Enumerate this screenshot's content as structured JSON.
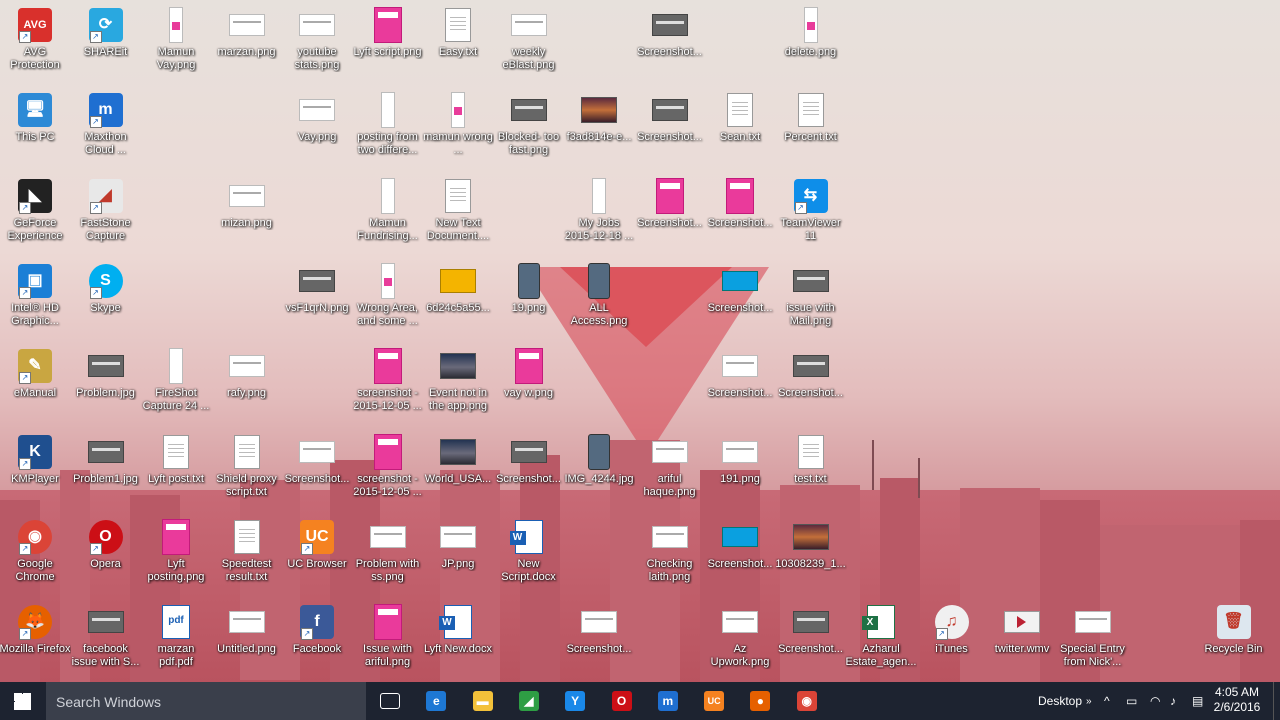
{
  "icons": [
    {
      "id": "avg",
      "label": "AVG Protection",
      "type": "app",
      "color": "#d9302c",
      "glyph": "AVG",
      "shortcut": true
    },
    {
      "id": "shareit",
      "label": "SHAREit",
      "type": "app",
      "color": "#29a8e0",
      "glyph": "⟳",
      "shortcut": true
    },
    {
      "id": "mamun-vay",
      "label": "Mamun Vay.png",
      "type": "tallp"
    },
    {
      "id": "marzan",
      "label": "marzan.png",
      "type": "thumb"
    },
    {
      "id": "youtube-stats",
      "label": "youtube stats.png",
      "type": "thumb"
    },
    {
      "id": "lyft-script",
      "label": "Lyft script.png",
      "type": "pink"
    },
    {
      "id": "easy",
      "label": "Easy.txt",
      "type": "doc"
    },
    {
      "id": "weekly-eblast",
      "label": "weekly eBlast.png",
      "type": "thumb"
    },
    {
      "id": "screenshot-1",
      "label": "Screenshot...",
      "type": "dark"
    },
    {
      "id": "delete",
      "label": "delete.png",
      "type": "tallp"
    },
    {
      "id": "this-pc",
      "label": "This PC",
      "type": "app",
      "color": "#2d8ad6",
      "glyph": "🖥"
    },
    {
      "id": "maxthon",
      "label": "Maxthon Cloud ...",
      "type": "app",
      "color": "#1f6fd1",
      "glyph": "m",
      "shortcut": true
    },
    {
      "id": "vay",
      "label": "Vay.png",
      "type": "thumb"
    },
    {
      "id": "posting-two",
      "label": "posting from two differe...",
      "type": "tall"
    },
    {
      "id": "mamun-wrong",
      "label": "mamun wrong ...",
      "type": "tallp"
    },
    {
      "id": "blocked-too-fast",
      "label": "Blocked- too fast.png",
      "type": "dark"
    },
    {
      "id": "f3ad8",
      "label": "f3ad814e-e...",
      "type": "photo"
    },
    {
      "id": "screenshot-2",
      "label": "Screenshot...",
      "type": "dark"
    },
    {
      "id": "sean",
      "label": "Sean.txt",
      "type": "doc"
    },
    {
      "id": "percent",
      "label": "Percent.txt",
      "type": "doc"
    },
    {
      "id": "geforce",
      "label": "GeForce Experience",
      "type": "app",
      "color": "#222",
      "glyph": "◣",
      "shortcut": true
    },
    {
      "id": "faststone",
      "label": "FastStone Capture",
      "type": "app",
      "color": "#e8e8e8",
      "glyph": "◢",
      "shortcut": true
    },
    {
      "id": "mizan",
      "label": "mizan.png",
      "type": "thumb"
    },
    {
      "id": "mamun-fundrising",
      "label": "Mamun Fundrising...",
      "type": "tall"
    },
    {
      "id": "new-text",
      "label": "New Text Document....",
      "type": "doc"
    },
    {
      "id": "my-jobs",
      "label": "My Jobs 2015-12-18 ...",
      "type": "tall"
    },
    {
      "id": "screenshot-3",
      "label": "Screenshot...",
      "type": "pink"
    },
    {
      "id": "screenshot-4",
      "label": "Screenshot...",
      "type": "pink"
    },
    {
      "id": "teamviewer",
      "label": "TeamViewer 11",
      "type": "app",
      "color": "#0e8ee9",
      "glyph": "⇆",
      "shortcut": true
    },
    {
      "id": "intel-hd",
      "label": "Intel® HD Graphic...",
      "type": "app",
      "color": "#1b7fd6",
      "glyph": "▣",
      "shortcut": true
    },
    {
      "id": "skype",
      "label": "Skype",
      "type": "app",
      "color": "#00aff0",
      "glyph": "S",
      "round": true,
      "shortcut": true
    },
    {
      "id": "vsf1",
      "label": "vsF1qrN.png",
      "type": "dark"
    },
    {
      "id": "wrong-area",
      "label": "Wrong Area, and some ...",
      "type": "tallp"
    },
    {
      "id": "6d24c",
      "label": "6d24c5a55...",
      "type": "yellow"
    },
    {
      "id": "19png",
      "label": "19.png",
      "type": "phone"
    },
    {
      "id": "all-access",
      "label": "ALL Access.png",
      "type": "phone"
    },
    {
      "id": "screenshot-5",
      "label": "Screenshot...",
      "type": "blue"
    },
    {
      "id": "issue-mail",
      "label": "issue with Mail.png",
      "type": "dark"
    },
    {
      "id": "emanual",
      "label": "eManual",
      "type": "app",
      "color": "#c9a641",
      "glyph": "✎",
      "shortcut": true
    },
    {
      "id": "problem-jpg",
      "label": "Problem.jpg",
      "type": "dark"
    },
    {
      "id": "fireshot",
      "label": "FireShot Capture 24 ...",
      "type": "tall"
    },
    {
      "id": "rafy",
      "label": "rafy.png",
      "type": "thumb"
    },
    {
      "id": "screenshot-2015-a",
      "label": "screenshot - 2015-12-05 ...",
      "type": "pink"
    },
    {
      "id": "event-not",
      "label": "Event not in the app.png",
      "type": "photo2"
    },
    {
      "id": "vay-w",
      "label": "vay w.png",
      "type": "pink"
    },
    {
      "id": "screenshot-6",
      "label": "Screenshot...",
      "type": "thumb"
    },
    {
      "id": "screenshot-7",
      "label": "Screenshot...",
      "type": "dark"
    },
    {
      "id": "kmplayer",
      "label": "KMPlayer",
      "type": "app",
      "color": "#1f4f8f",
      "glyph": "K",
      "shortcut": true
    },
    {
      "id": "problem1",
      "label": "Problem1.jpg",
      "type": "dark"
    },
    {
      "id": "lyft-post",
      "label": "Lyft post.txt",
      "type": "doc"
    },
    {
      "id": "shield-proxy",
      "label": "Shield proxy script.txt",
      "type": "doc"
    },
    {
      "id": "screenshot-8",
      "label": "Screenshot...",
      "type": "thumb"
    },
    {
      "id": "screenshot-2015-b",
      "label": "screenshot - 2015-12-05 ...",
      "type": "pink"
    },
    {
      "id": "world-usa",
      "label": "World_USA...",
      "type": "photo2"
    },
    {
      "id": "screenshot-9",
      "label": "Screenshot...",
      "type": "dark"
    },
    {
      "id": "img4244",
      "label": "IMG_4244.jpg",
      "type": "phone"
    },
    {
      "id": "ariful-haque",
      "label": "ariful haque.png",
      "type": "thumb"
    },
    {
      "id": "191png",
      "label": "191.png",
      "type": "thumb"
    },
    {
      "id": "test-txt",
      "label": "test.txt",
      "type": "doc"
    },
    {
      "id": "chrome",
      "label": "Google Chrome",
      "type": "app",
      "color": "#db4437",
      "glyph": "◉",
      "round": true,
      "shortcut": true
    },
    {
      "id": "opera",
      "label": "Opera",
      "type": "app",
      "color": "#cc0f16",
      "glyph": "O",
      "round": true,
      "shortcut": true
    },
    {
      "id": "lyft-posting",
      "label": "Lyft posting.png",
      "type": "pink"
    },
    {
      "id": "speedtest",
      "label": "Speedtest result.txt",
      "type": "doc"
    },
    {
      "id": "uc-browser",
      "label": "UC Browser",
      "type": "app",
      "color": "#f58220",
      "glyph": "UC",
      "shortcut": true
    },
    {
      "id": "problem-ss",
      "label": "Problem with ss.png",
      "type": "thumb"
    },
    {
      "id": "jp",
      "label": "JP.png",
      "type": "thumb"
    },
    {
      "id": "new-script",
      "label": "New Script.docx",
      "type": "word"
    },
    {
      "id": "checking-laith",
      "label": "Checking laith.png",
      "type": "thumb"
    },
    {
      "id": "screenshot-10",
      "label": "Screenshot...",
      "type": "blue"
    },
    {
      "id": "img10308",
      "label": "10308239_1...",
      "type": "photo"
    },
    {
      "id": "firefox",
      "label": "Mozilla Firefox",
      "type": "app",
      "color": "#e66000",
      "glyph": "🦊",
      "round": true,
      "shortcut": true
    },
    {
      "id": "facebook-issue",
      "label": "facebook issue with S...",
      "type": "dark"
    },
    {
      "id": "marzan-pdf",
      "label": "marzan pdf.pdf",
      "type": "pdf"
    },
    {
      "id": "untitled",
      "label": "Untitled.png",
      "type": "thumb"
    },
    {
      "id": "facebook",
      "label": "Facebook",
      "type": "app",
      "color": "#3b5998",
      "glyph": "f",
      "shortcut": true
    },
    {
      "id": "issue-ariful",
      "label": "Issue with ariful.png",
      "type": "pink"
    },
    {
      "id": "lyft-new",
      "label": "Lyft New.docx",
      "type": "word"
    },
    {
      "id": "screenshot-11",
      "label": "Screenshot...",
      "type": "thumb"
    },
    {
      "id": "az-upwork",
      "label": "Az Upwork.png",
      "type": "thumb"
    },
    {
      "id": "screenshot-12",
      "label": "Screenshot...",
      "type": "dark"
    },
    {
      "id": "azharul",
      "label": "Azharul Estate_agen...",
      "type": "excel"
    },
    {
      "id": "itunes",
      "label": "iTunes",
      "type": "app",
      "color": "#f0f0f0",
      "glyph": "♫",
      "round": true,
      "shortcut": true
    },
    {
      "id": "twitter-wmv",
      "label": "twitter.wmv",
      "type": "vid"
    },
    {
      "id": "special-entry",
      "label": "Special Entry from Nick'...",
      "type": "thumb"
    },
    {
      "id": "recycle-bin",
      "label": "Recycle Bin",
      "type": "app",
      "color": "#dde7ef",
      "glyph": "🗑"
    }
  ],
  "taskbar": {
    "search_placeholder": "Search Windows",
    "apps": [
      {
        "id": "task-view",
        "glyph": "▭",
        "color": "transparent"
      },
      {
        "id": "edge",
        "glyph": "e",
        "color": "#1e78d4"
      },
      {
        "id": "file-explorer",
        "glyph": "▬",
        "color": "#f3c13a"
      },
      {
        "id": "faststone",
        "glyph": "◢",
        "color": "#2e9e44"
      },
      {
        "id": "network-app",
        "glyph": "Y",
        "color": "#1a88e8"
      },
      {
        "id": "opera",
        "glyph": "O",
        "color": "#cc0f16"
      },
      {
        "id": "maxthon",
        "glyph": "m",
        "color": "#1f6fd1"
      },
      {
        "id": "uc-browser",
        "glyph": "UC",
        "color": "#f58220"
      },
      {
        "id": "firefox",
        "glyph": "●",
        "color": "#e66000"
      },
      {
        "id": "chrome",
        "glyph": "◉",
        "color": "#db4437"
      }
    ],
    "desktop_label": "Desktop",
    "time": "4:05 AM",
    "date": "2/6/2016"
  }
}
